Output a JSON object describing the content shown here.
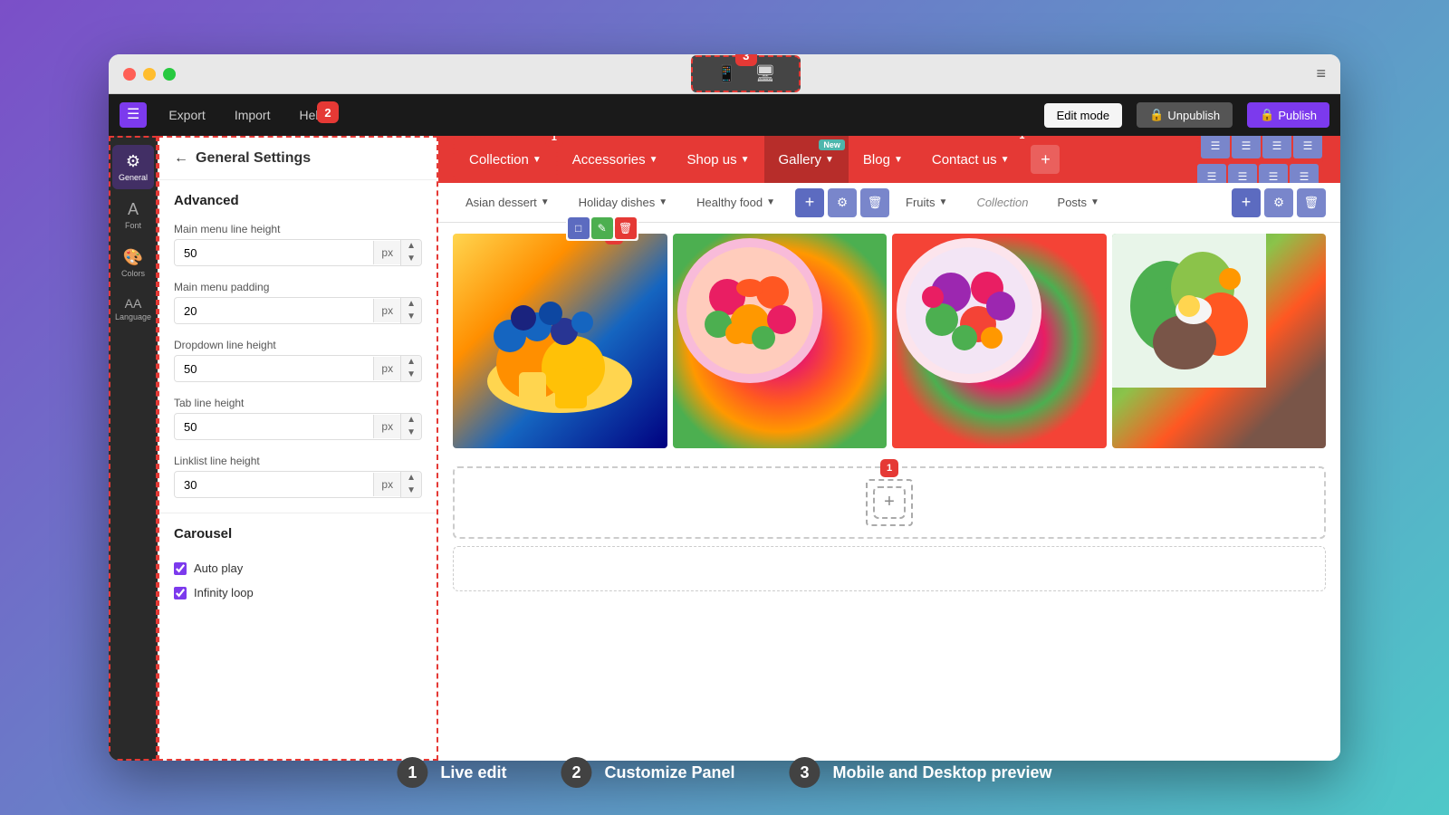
{
  "browser": {
    "traffic_lights": [
      "red",
      "yellow",
      "green"
    ]
  },
  "device_bar": {
    "badge": "3",
    "mobile_icon": "📱",
    "desktop_icon": "🖥"
  },
  "toolbar": {
    "hamburger_icon": "☰",
    "export_label": "Export",
    "import_label": "Import",
    "help_label": "Help",
    "badge_2": "2",
    "edit_mode_label": "Edit mode",
    "unpublish_label": "Unpublish",
    "publish_label": "Publish"
  },
  "sidebar": {
    "items": [
      {
        "icon": "⚙",
        "label": "General"
      },
      {
        "icon": "A",
        "label": "Font"
      },
      {
        "icon": "🎨",
        "label": "Colors"
      },
      {
        "icon": "AA",
        "label": "Language"
      }
    ]
  },
  "settings_panel": {
    "title": "General Settings",
    "section_advanced": "Advanced",
    "fields": [
      {
        "label": "Main menu line height",
        "value": "50",
        "unit": "px"
      },
      {
        "label": "Main menu padding",
        "value": "20",
        "unit": "px"
      },
      {
        "label": "Dropdown line height",
        "value": "50",
        "unit": "px"
      },
      {
        "label": "Tab line height",
        "value": "50",
        "unit": "px"
      },
      {
        "label": "Linklist line height",
        "value": "30",
        "unit": "px"
      }
    ],
    "section_carousel": "Carousel",
    "checkboxes": [
      {
        "label": "Auto play",
        "checked": true
      },
      {
        "label": "Infinity loop",
        "checked": true
      }
    ]
  },
  "website_nav": {
    "items": [
      {
        "label": "Collection",
        "icon": "▼",
        "active": false
      },
      {
        "label": "Accessories",
        "icon": "▼",
        "active": false
      },
      {
        "label": "Shop us",
        "icon": "▼",
        "active": false
      },
      {
        "label": "Gallery",
        "icon": "▼",
        "active": true,
        "badge_new": "New"
      },
      {
        "label": "Blog",
        "icon": "▼",
        "active": false
      },
      {
        "label": "Contact us",
        "icon": "▼",
        "active": false
      }
    ],
    "plus_label": "+"
  },
  "website_subnav": {
    "items": [
      {
        "label": "Asian dessert",
        "icon": "▼"
      },
      {
        "label": "Holiday dishes",
        "icon": "▼"
      },
      {
        "label": "Healthy food",
        "icon": "▼"
      },
      {
        "label": "Fruits",
        "icon": "▼"
      },
      {
        "label": "Collection",
        "icon": ""
      },
      {
        "label": "Posts",
        "icon": "▼"
      }
    ]
  },
  "gallery": {
    "images": [
      {
        "alt": "Mango and blueberry bowl"
      },
      {
        "alt": "Colorful fruit bowl"
      },
      {
        "alt": "Mixed fruit salad"
      },
      {
        "alt": "Vegetable platter"
      }
    ]
  },
  "legend": {
    "items": [
      {
        "badge": "1",
        "label": "Live edit"
      },
      {
        "badge": "2",
        "label": "Customize Panel"
      },
      {
        "badge": "3",
        "label": "Mobile and Desktop preview"
      }
    ]
  }
}
